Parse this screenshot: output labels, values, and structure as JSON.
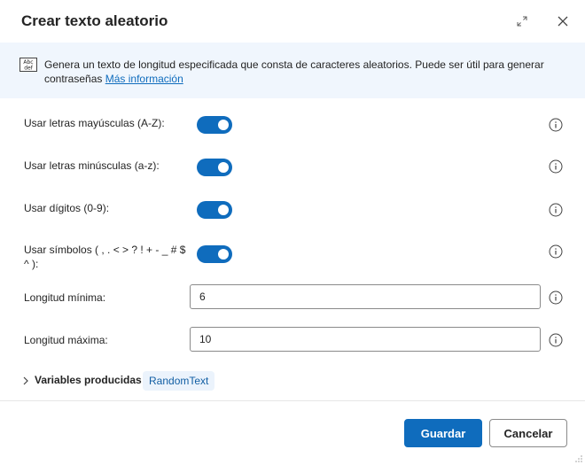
{
  "dialog": {
    "title": "Crear texto aleatorio",
    "expand_icon": "expand-icon",
    "close_icon": "close-icon"
  },
  "banner": {
    "icon": "text-abc-def-icon",
    "text": "Genera un texto de longitud especificada que consta de caracteres aleatorios. Puede ser útil para generar contraseñas",
    "link": "Más información"
  },
  "options": [
    {
      "label": "Usar letras mayúsculas (A-Z):",
      "enabled": true
    },
    {
      "label": "Usar letras minúsculas (a-z):",
      "enabled": true
    },
    {
      "label": "Usar dígitos (0-9):",
      "enabled": true
    },
    {
      "label": "Usar símbolos ( , . < > ? ! + - _ # $ ^ ):",
      "enabled": true
    }
  ],
  "fields": {
    "min_length": {
      "label": "Longitud mínima:",
      "value": "6"
    },
    "max_length": {
      "label": "Longitud máxima:",
      "value": "10"
    }
  },
  "variables": {
    "label": "Variables producidas",
    "items": [
      "RandomText"
    ]
  },
  "buttons": {
    "save": "Guardar",
    "cancel": "Cancelar"
  },
  "colors": {
    "accent": "#0f6cbd",
    "banner_bg": "#f0f6fd",
    "chip_bg": "#ebf3fc"
  }
}
